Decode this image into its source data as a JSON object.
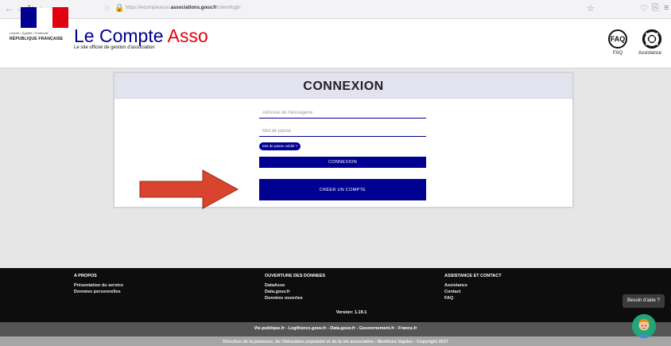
{
  "browser": {
    "url_prefix": "https://lecompteasso.",
    "url_domain": "associations.gouv.fr",
    "url_path": "/client/login"
  },
  "header": {
    "devise": "Liberté • Égalité • Fraternité",
    "republique": "RÉPUBLIQUE FRANÇAISE",
    "brand_main": "Le Compte ",
    "brand_accent": "Asso",
    "tagline": "Le site officiel de gestion d'association",
    "faq_icon_text": "FAQ",
    "faq_label": "FAQ",
    "assistance_label": "Assistance"
  },
  "login": {
    "title": "CONNEXION",
    "email_placeholder": "Adresse de messagerie",
    "password_placeholder": "Mot de passe",
    "forgot_label": "Mot de passe oublié ?",
    "connexion_button": "CONNEXION",
    "create_account_button": "CRÉER UN COMPTE"
  },
  "footer": {
    "col1_title": "A PROPOS",
    "col1_links": [
      "Présentation du service",
      "Données personnelles"
    ],
    "col2_title": "OUVERTURE DES DONNEES",
    "col2_links": [
      "DataAsso",
      "Data.gouv.fr",
      "Données ouvertes"
    ],
    "col3_title": "ASSISTANCE ET CONTACT",
    "col3_links": [
      "Assistance",
      "Contact",
      "FAQ"
    ],
    "version": "Version: 1.19.1",
    "gov_links": "Vie-publique.fr - Legifrance.gouv.fr - Data.gouv.fr - Gouvernement.fr - France.fr",
    "bottom_text": "Direction de la jeunesse, de l'éducation populaire et de la vie associative - Mentions légales - Copyright 2017"
  },
  "help": {
    "bubble_label": "Besoin d'aide ?"
  },
  "colors": {
    "primary": "#000091",
    "accent_red": "#e1000f",
    "arrow": "#d9442e"
  }
}
